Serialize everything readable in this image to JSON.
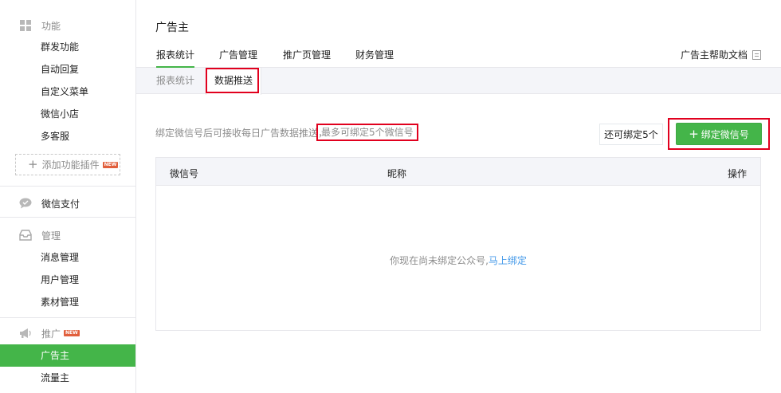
{
  "sidebar": {
    "features_header": "功能",
    "features_items": [
      "群发功能",
      "自动回复",
      "自定义菜单",
      "微信小店",
      "多客服"
    ],
    "add_plugin_label": "添加功能插件",
    "new_badge": "NEW",
    "payment_header": "微信支付",
    "manage_header": "管理",
    "manage_items": [
      "消息管理",
      "用户管理",
      "素材管理"
    ],
    "promo_header": "推广",
    "promo_items": [
      "广告主",
      "流量主"
    ]
  },
  "main": {
    "title": "广告主",
    "tabs": [
      "报表统计",
      "广告管理",
      "推广页管理",
      "财务管理"
    ],
    "help_doc": "广告主帮助文档",
    "subtabs": [
      "报表统计",
      "数据推送"
    ],
    "notice_text": "绑定微信号后可接收每日广告数据推送，",
    "notice_limit": "最多可绑定5个微信号",
    "remain_button": "还可绑定5个",
    "bind_button": "绑定微信号",
    "table": {
      "columns": [
        "微信号",
        "昵称",
        "操作"
      ],
      "empty_text": "你现在尚未绑定公众号,",
      "empty_link": "马上绑定"
    }
  },
  "colors": {
    "accent_green": "#44b549",
    "highlight_red": "#e1001e",
    "link_blue": "#459ae9",
    "new_badge": "#e15f3c"
  }
}
